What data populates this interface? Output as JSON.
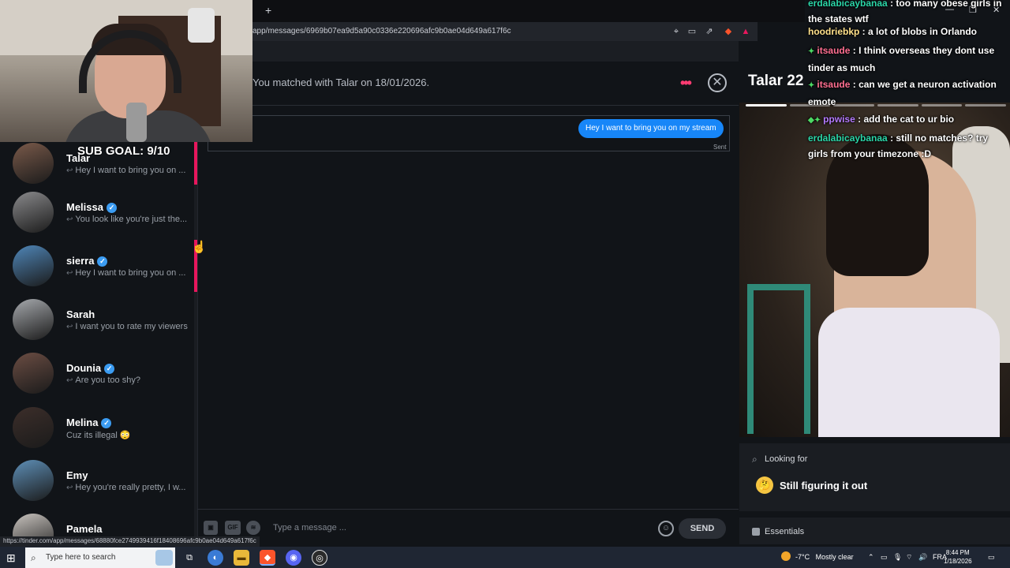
{
  "browser": {
    "new_tab": "+",
    "url": "app/messages/6969b07ea9d5a90c0336e220696afc9b0ae04d649a617f6c",
    "status_url": "https://tinder.com/app/messages/68880fce2749939416f18408696afc9b0ae04d649a617f6c"
  },
  "stream": {
    "sub_goal": "SUB GOAL: 9/10"
  },
  "matches": [
    {
      "name": "Talar",
      "verified": false,
      "preview": "Hey I want to bring you on ...",
      "active": true,
      "avatar": "#7a5a4a"
    },
    {
      "name": "Melissa",
      "verified": true,
      "preview": "You look like you're just the...",
      "active": false,
      "avatar": "#8a8a8c"
    },
    {
      "name": "sierra",
      "verified": true,
      "preview": "Hey I want to bring you on ...",
      "active": false,
      "avatar": "#4f86b8"
    },
    {
      "name": "Sarah",
      "verified": false,
      "preview": "I want you to rate my viewers",
      "active": false,
      "avatar": "#a6a9ad"
    },
    {
      "name": "Dounia",
      "verified": true,
      "preview": "Are you too shy?",
      "active": false,
      "avatar": "#6b4d43"
    },
    {
      "name": "Melina",
      "verified": true,
      "preview": "Cuz its illegal 😳",
      "active": false,
      "avatar": "#3c2e2a"
    },
    {
      "name": "Emy",
      "verified": false,
      "preview": "Hey you're really pretty, I w...",
      "active": false,
      "avatar": "#5e8fb7"
    },
    {
      "name": "Pamela",
      "verified": false,
      "preview": "",
      "active": false,
      "avatar": "#c9c4bf"
    }
  ],
  "conversation": {
    "match_info": "You matched with Talar on 18/01/2026.",
    "messages": [
      {
        "text": "Hey I want to bring you on my stream",
        "status": "Sent"
      }
    ],
    "composer_placeholder": "Type a message ...",
    "gif_label": "GIF",
    "send_label": "SEND"
  },
  "profile": {
    "name": "Talar 22",
    "photo_count": 6,
    "looking_for_title": "Looking for",
    "looking_for_value": "Still figuring it out",
    "looking_for_emoji": "🤔",
    "essentials_title": "Essentials"
  },
  "twitch_chat": [
    {
      "user": "erdalabicaybanaa",
      "user_color": "#2bd6a8",
      "badges": "",
      "text": "too many obese girls in the states wtf"
    },
    {
      "user": "hoodriebkp",
      "user_color": "#ffe08a",
      "badges": "",
      "text": "a lot of blobs in Orlando"
    },
    {
      "user": "itsaude",
      "user_color": "#ff6f91",
      "badges": "✦",
      "text": "I think overseas they dont use tinder as much"
    },
    {
      "user": "itsaude",
      "user_color": "#ff6f91",
      "badges": "✦",
      "text": "can we get a neuron activation emote"
    },
    {
      "user": "ppwise",
      "user_color": "#b57bff",
      "badges": "◆✦",
      "text": "add the cat to ur bio"
    },
    {
      "user": "erdalabicaybanaa",
      "user_color": "#2bd6a8",
      "badges": "",
      "text": "still no matches? try girls from your timezone :D"
    }
  ],
  "taskbar": {
    "search_placeholder": "Type here to search",
    "weather_temp": "-7°C",
    "weather_text": "Mostly clear",
    "language": "FRA",
    "time": "8:44 PM",
    "date": "1/18/2026"
  },
  "colors": {
    "accent": "#fe3c72",
    "bubble": "#1786f8",
    "verified": "#3b9cf2"
  }
}
